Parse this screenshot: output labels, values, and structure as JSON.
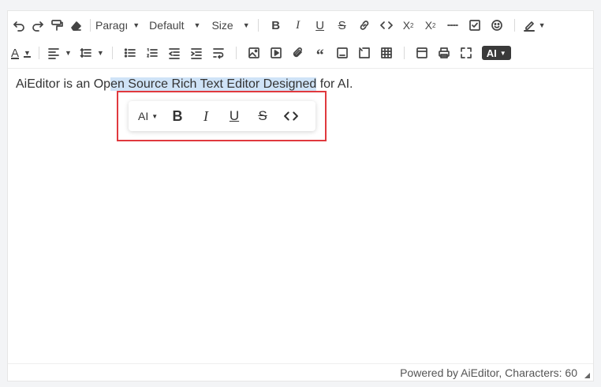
{
  "toolbar": {
    "heading_select": "Paragı",
    "font_family_select": "Default",
    "font_size_select": "Size",
    "ai_button_label": "AI"
  },
  "document": {
    "text_before": "AiEditor is an Op",
    "text_selected": "en Source Rich Text Editor Designed",
    "text_after": " for AI."
  },
  "bubble_menu": {
    "ai_label": "AI"
  },
  "footer": {
    "status": "Powered by AiEditor, Characters: 60"
  },
  "colors": {
    "selection": "#cfe3f7",
    "highlight_box": "#e0393e"
  }
}
